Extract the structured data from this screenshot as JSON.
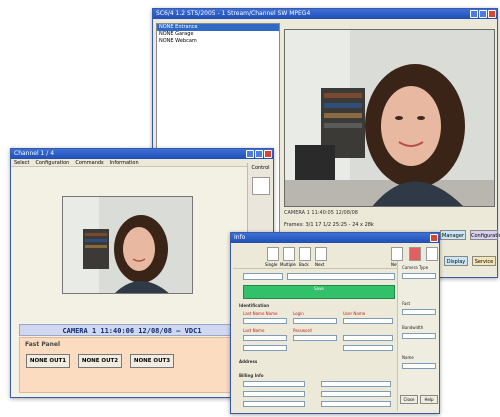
{
  "back_window": {
    "title": "SC6/4 1.2 STS/2005 - 1 Stream/Channel SW MPEG4",
    "list": [
      "NONE Entrance",
      "NONE Garage",
      "NONE Webcam"
    ],
    "caption": "CAMERA 1 11:40:05 12/08/08",
    "status": "Frames: 3/1 17 1/2 25:25 - 24 x 28k"
  },
  "mid_window": {
    "title": "Channel 1 / 4",
    "menu": [
      "Select",
      "Configuration",
      "Commands",
      "Information"
    ],
    "side_label": "Control",
    "timebar": "CAMERA 1 11:40:06 12/08/08 — VDC1",
    "fast_panel": {
      "title": "Fast Panel",
      "buttons": [
        "NONE OUT1",
        "NONE OUT2",
        "NONE OUT3"
      ]
    }
  },
  "front_dialog": {
    "title": "Info",
    "tools": [
      "Single",
      "Multiple",
      "Back",
      "Next"
    ],
    "right_buttons": [
      "New",
      "Modify",
      "Delete"
    ],
    "green_label": "Save",
    "sections": [
      "Identification",
      "Address",
      "Billing Info"
    ],
    "right_labels": [
      "Camera Type",
      "Fast",
      "Bandwidth",
      "Name"
    ],
    "bottom_labels": [
      "Close",
      "Help"
    ],
    "red_fields": [
      "Last Name Name",
      "Login",
      "User Name",
      "Last Name",
      "Password"
    ]
  },
  "extra_pills": [
    "Manager",
    "Configuration",
    "Display",
    "Service"
  ],
  "colors": {
    "title_blue": "#1f4fb4",
    "fast_panel_bg": "#fbdcc0",
    "green_bar": "#33c06a",
    "pink_button": "#e26ab0"
  }
}
